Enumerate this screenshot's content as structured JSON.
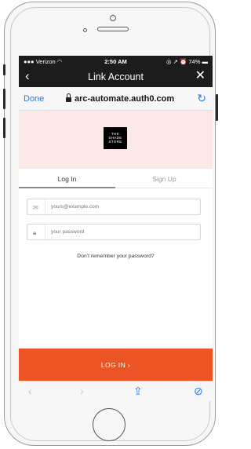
{
  "status": {
    "carrier": "Verizon",
    "time": "2:50 AM",
    "battery": "74%"
  },
  "nav": {
    "title": "Link Account",
    "back": "‹",
    "close": "✕"
  },
  "browser": {
    "done": "Done",
    "url": "arc-automate.auth0.com"
  },
  "logo": {
    "line1": "THE",
    "line2": "SHADE",
    "line3": "STORE"
  },
  "tabs": {
    "login": "Log In",
    "signup": "Sign Up"
  },
  "form": {
    "email_placeholder": "yours@example.com",
    "password_placeholder": "your password",
    "forgot": "Don't remember your password?"
  },
  "submit": {
    "label": "LOG IN ›"
  },
  "colors": {
    "accent": "#eb5525",
    "link": "#2a7ae4",
    "banner": "#fbe9e7"
  }
}
